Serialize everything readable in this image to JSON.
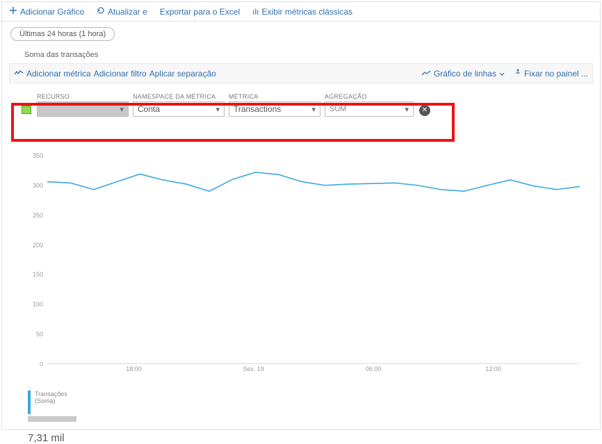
{
  "toolbar": {
    "add_chart": "Adicionar Gráfico",
    "update": "Atualizar e",
    "export_excel": "Exportar para o Excel",
    "show_classic": "Exibir métricas clássicas"
  },
  "time_chip": "Últimas 24 horas (1 hora)",
  "section_title": "Soma das transações",
  "sub_toolbar": {
    "add_metric": "Adicionar métrica",
    "add_filter": "Adicionar filtro",
    "apply_split": "Aplicar separação",
    "line_chart": "Gráfico de linhas",
    "pin": "Fixar no painel ..."
  },
  "fields": {
    "recurso": {
      "label": "RECURSO",
      "value": ""
    },
    "namespace": {
      "label": "NAMESPACE DA MÉTRICA",
      "value": "Conta"
    },
    "metrica": {
      "label": "MÉTRICA",
      "value": "Transactions"
    },
    "agregacao": {
      "label": "AGREGAÇÃO",
      "value": "SUM"
    }
  },
  "legend": {
    "name": "Transações (Soma)",
    "value": "7,31 mil"
  },
  "chart_data": {
    "type": "line",
    "title": "Soma das transações",
    "xlabel": "",
    "ylabel": "",
    "ylim": [
      0,
      350
    ],
    "y_ticks": [
      0,
      50,
      100,
      150,
      200,
      250,
      300,
      350
    ],
    "x_ticks": [
      "18:00",
      "Sex. 19",
      "06:00",
      "12:00"
    ],
    "x": [
      0,
      1,
      2,
      3,
      4,
      5,
      6,
      7,
      8,
      9,
      10,
      11,
      12,
      13,
      14,
      15,
      16,
      17,
      18,
      19,
      20,
      21,
      22,
      23
    ],
    "series": [
      {
        "name": "Transações (Soma)",
        "color": "#3aa6e2",
        "values": [
          306,
          304,
          293,
          306,
          319,
          309,
          302,
          290,
          310,
          322,
          318,
          306,
          300,
          302,
          303,
          304,
          300,
          293,
          290,
          300,
          309,
          299,
          293,
          298
        ]
      }
    ]
  }
}
